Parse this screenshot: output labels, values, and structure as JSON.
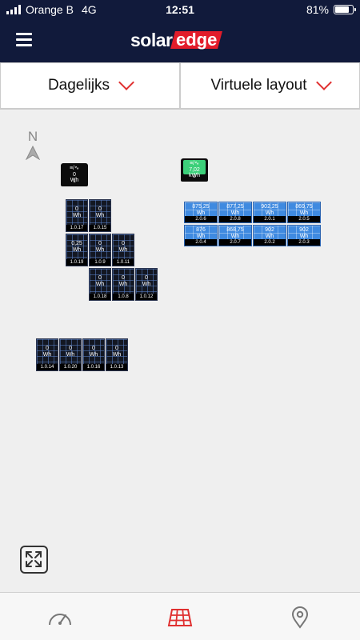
{
  "status": {
    "carrier": "Orange B",
    "network": "4G",
    "time": "12:51",
    "battery": "81%",
    "battery_level": 0.81
  },
  "header": {
    "logo_solar": "solar",
    "logo_edge": "edge",
    "brand_color": "#e21c2a",
    "bg_color": "#111a3b"
  },
  "filters": {
    "period": "Dagelijks",
    "view": "Virtuele layout",
    "chevron": "chevron-down-icon"
  },
  "compass": {
    "label": "N"
  },
  "inverters": [
    {
      "top": "≡/∿",
      "value": "0",
      "unit": "Wh",
      "id": "1",
      "color": "#0c0c0c"
    },
    {
      "top": "≡/∿",
      "value": "7,02",
      "unit": "kWh",
      "id": "2",
      "color": "#3cd07a"
    }
  ],
  "modules": [
    {
      "value": "0",
      "unit": "Wh",
      "id": "1.0.17"
    },
    {
      "value": "0",
      "unit": "Wh",
      "id": "1.0.15"
    },
    {
      "value": "0,25",
      "unit": "Wh",
      "id": "1.0.19"
    },
    {
      "value": "0",
      "unit": "Wh",
      "id": "1.0.9"
    },
    {
      "value": "0",
      "unit": "Wh",
      "id": "1.0.11"
    },
    {
      "value": "0",
      "unit": "Wh",
      "id": "1.0.18"
    },
    {
      "value": "0",
      "unit": "Wh",
      "id": "1.0.8"
    },
    {
      "value": "0",
      "unit": "Wh",
      "id": "1.0.12"
    },
    {
      "value": "0",
      "unit": "Wh",
      "id": "1.0.14"
    },
    {
      "value": "0",
      "unit": "Wh",
      "id": "1.0.20"
    },
    {
      "value": "0",
      "unit": "Wh",
      "id": "1.0.16"
    },
    {
      "value": "0",
      "unit": "Wh",
      "id": "1.0.13"
    }
  ],
  "blue_modules": [
    {
      "value": "875,25",
      "unit": "Wh",
      "id": "2.0.6"
    },
    {
      "value": "877,25",
      "unit": "Wh",
      "id": "2.0.8"
    },
    {
      "value": "902,25",
      "unit": "Wh",
      "id": "2.0.1"
    },
    {
      "value": "869,75",
      "unit": "Wh",
      "id": "2.0.5"
    },
    {
      "value": "876",
      "unit": "Wh",
      "id": "2.0.4"
    },
    {
      "value": "868,75",
      "unit": "Wh",
      "id": "2.0.7"
    },
    {
      "value": "902",
      "unit": "Wh",
      "id": "2.0.2"
    },
    {
      "value": "902",
      "unit": "Wh",
      "id": "2.0.3"
    }
  ],
  "controls": {
    "expand": "expand-icon"
  },
  "tabs": [
    {
      "icon": "dashboard-gauge-icon",
      "active": false
    },
    {
      "icon": "layout-grid-icon",
      "active": true
    },
    {
      "icon": "location-pin-icon",
      "active": false
    }
  ]
}
